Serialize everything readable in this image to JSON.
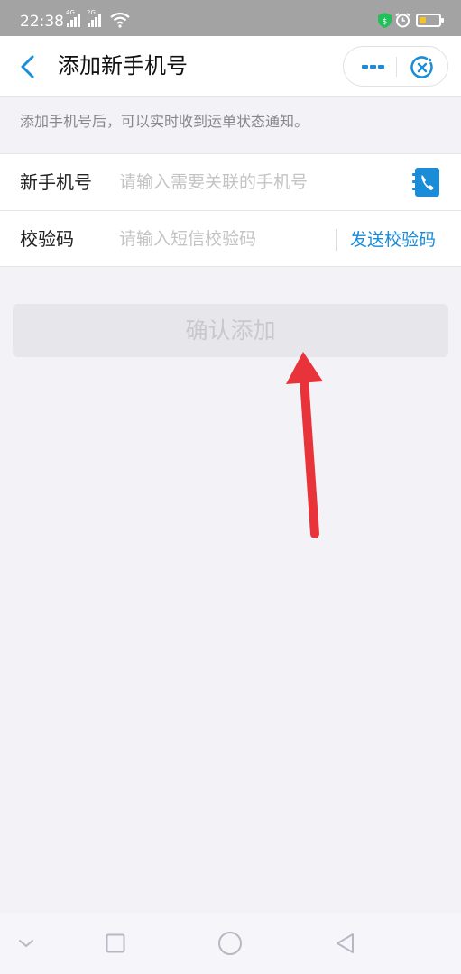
{
  "status_bar": {
    "time": "22:38",
    "signal1_label": "4G",
    "signal2_label": "2G",
    "battery_color": "#f3c22f",
    "security_badge_color": "#23c05a"
  },
  "nav": {
    "title": "添加新手机号",
    "accent_color": "#1a8cd8"
  },
  "notice": "添加手机号后，可以实时收到运单状态通知。",
  "form": {
    "phone": {
      "label": "新手机号",
      "placeholder": "请输入需要关联的手机号",
      "value": ""
    },
    "code": {
      "label": "校验码",
      "placeholder": "请输入短信校验码",
      "value": "",
      "send_label": "发送校验码"
    }
  },
  "confirm_label": "确认添加",
  "annotation": {
    "arrow_color": "#e8333a"
  }
}
